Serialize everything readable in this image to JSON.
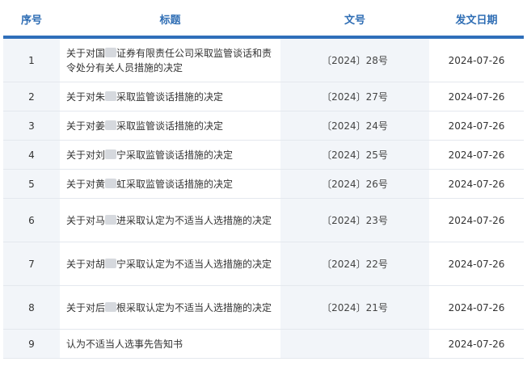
{
  "header": {
    "col_index": "序号",
    "col_title": "标题",
    "col_doc": "文号",
    "col_date": "发文日期"
  },
  "rows": [
    {
      "index": "1",
      "title": "关于对国▒证券有限责任公司采取监管谈话和责令处分有关人员措施的决定",
      "doc": "〔2024〕28号",
      "date": "2024-07-26"
    },
    {
      "index": "2",
      "title": "关于对朱▒采取监管谈话措施的决定",
      "doc": "〔2024〕27号",
      "date": "2024-07-26"
    },
    {
      "index": "3",
      "title": "关于对姜▒采取监管谈话措施的决定",
      "doc": "〔2024〕24号",
      "date": "2024-07-26"
    },
    {
      "index": "4",
      "title": "关于对刘▒宁采取监管谈话措施的决定",
      "doc": "〔2024〕25号",
      "date": "2024-07-26"
    },
    {
      "index": "5",
      "title": "关于对黄▒虹采取监管谈话措施的决定",
      "doc": "〔2024〕26号",
      "date": "2024-07-26"
    },
    {
      "index": "6",
      "title": "关于对马▒进采取认定为不适当人选措施的决定",
      "doc": "〔2024〕23号",
      "date": "2024-07-26"
    },
    {
      "index": "7",
      "title": "关于对胡▒宁采取认定为不适当人选措施的决定",
      "doc": "〔2024〕22号",
      "date": "2024-07-26"
    },
    {
      "index": "8",
      "title": "关于对后▒根采取认定为不适当人选措施的决定",
      "doc": "〔2024〕21号",
      "date": "2024-07-26"
    },
    {
      "index": "9",
      "title": "认为不适当人选事先告知书",
      "doc": "",
      "date": "2024-07-26"
    }
  ]
}
